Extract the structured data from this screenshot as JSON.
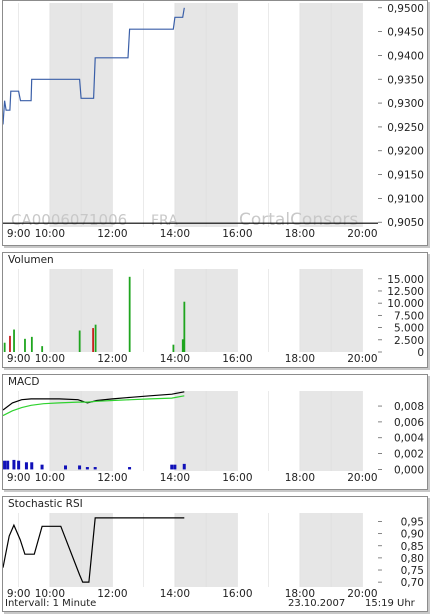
{
  "colors": {
    "band": "#e6e6e6",
    "grid": "#ffffff",
    "price_line": "#3a5fa8",
    "baseline": "#000000",
    "volume_up": "#1fa51f",
    "volume_down": "#c81f1f",
    "macd_line": "#000000",
    "signal_line": "#2fd22f",
    "histogram": "#1010b8",
    "rsi_line": "#000000",
    "watermark": "#c8c8c8"
  },
  "watermark": {
    "isin": "CA0006071006",
    "exchange": "FRA",
    "brand": "CortalConsors"
  },
  "footer": {
    "interval": "Intervall: 1 Minute",
    "date": "23.10.2007",
    "time": "15:19 Uhr"
  },
  "chart_data": [
    {
      "id": "price",
      "type": "line",
      "title": "",
      "x_tick_labels": [
        "9:00",
        "10:00",
        "12:00",
        "14:00",
        "16:00",
        "18:00",
        "20:00"
      ],
      "y_tick_labels": [
        "0,9500",
        "0,9450",
        "0,9400",
        "0,9350",
        "0,9300",
        "0,9250",
        "0,9200",
        "0,9150",
        "0,9100",
        "0,9050"
      ],
      "ylim": [
        0.904,
        0.951
      ],
      "xlim": [
        8.5,
        20.5
      ],
      "baseline": 0.9048,
      "series": [
        {
          "x": [
            8.5,
            8.55,
            8.6,
            8.72,
            8.75,
            9.0,
            9.06,
            9.4,
            9.42,
            10.1,
            10.15,
            10.95,
            11.0,
            11.4,
            11.45,
            12.5,
            12.55,
            13.95,
            14.0,
            14.25,
            14.3
          ],
          "y": [
            0.9255,
            0.9305,
            0.9285,
            0.9285,
            0.9325,
            0.9325,
            0.9305,
            0.9305,
            0.935,
            0.935,
            0.935,
            0.935,
            0.931,
            0.931,
            0.9395,
            0.9395,
            0.9455,
            0.9455,
            0.948,
            0.948,
            0.95
          ]
        }
      ]
    },
    {
      "id": "volume",
      "type": "bar",
      "title": "Volumen",
      "y_tick_labels": [
        "15.000",
        "12.500",
        "10.000",
        "7.500",
        "5.000",
        "2.500",
        "0"
      ],
      "ylim": [
        0,
        17000
      ],
      "x_tick_labels": [
        "9:00",
        "10:00",
        "12:00",
        "14:00",
        "16:00",
        "18:00",
        "20:00"
      ],
      "xlim": [
        8.5,
        20.5
      ],
      "bars": [
        {
          "x": 8.55,
          "value": 1900,
          "dir": "up"
        },
        {
          "x": 8.72,
          "value": 3300,
          "dir": "down"
        },
        {
          "x": 8.85,
          "value": 4600,
          "dir": "up"
        },
        {
          "x": 9.2,
          "value": 2700,
          "dir": "up"
        },
        {
          "x": 9.42,
          "value": 3100,
          "dir": "up"
        },
        {
          "x": 9.75,
          "value": 1200,
          "dir": "up"
        },
        {
          "x": 10.95,
          "value": 4400,
          "dir": "up"
        },
        {
          "x": 11.38,
          "value": 4900,
          "dir": "down"
        },
        {
          "x": 11.46,
          "value": 5600,
          "dir": "up"
        },
        {
          "x": 12.55,
          "value": 15400,
          "dir": "up"
        },
        {
          "x": 13.95,
          "value": 1500,
          "dir": "up"
        },
        {
          "x": 14.25,
          "value": 2600,
          "dir": "up"
        },
        {
          "x": 14.3,
          "value": 10300,
          "dir": "up"
        }
      ]
    },
    {
      "id": "macd",
      "type": "line",
      "title": "MACD",
      "y_tick_labels": [
        "0,008",
        "0,006",
        "0,004",
        "0,002",
        "0,000"
      ],
      "ylim": [
        -0.0002,
        0.0099
      ],
      "x_tick_labels": [
        "9:00",
        "10:00",
        "12:00",
        "14:00",
        "16:00",
        "18:00",
        "20:00"
      ],
      "xlim": [
        8.5,
        20.5
      ],
      "series": [
        {
          "role": "macd",
          "x": [
            8.5,
            8.8,
            9.1,
            9.4,
            9.8,
            10.3,
            10.9,
            11.2,
            11.5,
            12.0,
            12.6,
            13.2,
            13.9,
            14.3
          ],
          "y": [
            0.0075,
            0.0084,
            0.0088,
            0.0089,
            0.0089,
            0.0089,
            0.0088,
            0.0084,
            0.0087,
            0.0089,
            0.0091,
            0.0093,
            0.0095,
            0.0098
          ]
        },
        {
          "role": "signal",
          "x": [
            8.5,
            8.8,
            9.1,
            9.4,
            9.8,
            10.3,
            10.9,
            11.2,
            11.5,
            12.0,
            12.6,
            13.2,
            13.9,
            14.3
          ],
          "y": [
            0.0068,
            0.0074,
            0.0078,
            0.0081,
            0.0083,
            0.0084,
            0.0085,
            0.0085,
            0.0086,
            0.0087,
            0.0088,
            0.0089,
            0.009,
            0.0093
          ]
        }
      ],
      "histogram": [
        {
          "x": 8.55,
          "value": 0.0011
        },
        {
          "x": 8.65,
          "value": 0.0011
        },
        {
          "x": 8.85,
          "value": 0.0012
        },
        {
          "x": 9.0,
          "value": 0.0011
        },
        {
          "x": 9.25,
          "value": 0.0009
        },
        {
          "x": 9.42,
          "value": 0.0009
        },
        {
          "x": 9.75,
          "value": 0.0006
        },
        {
          "x": 10.5,
          "value": 0.0005
        },
        {
          "x": 10.95,
          "value": 0.0005
        },
        {
          "x": 11.2,
          "value": 0.0003
        },
        {
          "x": 11.45,
          "value": 0.0003
        },
        {
          "x": 12.55,
          "value": 0.0003
        },
        {
          "x": 13.9,
          "value": 0.0006
        },
        {
          "x": 14.0,
          "value": 0.0006
        },
        {
          "x": 14.3,
          "value": 0.0007
        }
      ]
    },
    {
      "id": "stoch_rsi",
      "type": "line",
      "title": "Stochastic RSI",
      "y_tick_labels": [
        "0,95",
        "0,90",
        "0,85",
        "0,80",
        "0,75",
        "0,70"
      ],
      "ylim": [
        0.68,
        0.985
      ],
      "x_tick_labels": [
        "9:00",
        "10:00",
        "12:00",
        "14:00",
        "16:00",
        "18:00",
        "20:00"
      ],
      "xlim": [
        8.5,
        20.5
      ],
      "series": [
        {
          "x": [
            8.5,
            8.7,
            8.85,
            9.05,
            9.2,
            9.5,
            9.75,
            10.1,
            10.35,
            10.95,
            11.05,
            11.25,
            11.45,
            12.0,
            13.0,
            14.3
          ],
          "y": [
            0.76,
            0.89,
            0.935,
            0.875,
            0.815,
            0.815,
            0.93,
            0.93,
            0.93,
            0.73,
            0.7,
            0.7,
            0.965,
            0.965,
            0.965,
            0.965
          ]
        }
      ]
    }
  ]
}
